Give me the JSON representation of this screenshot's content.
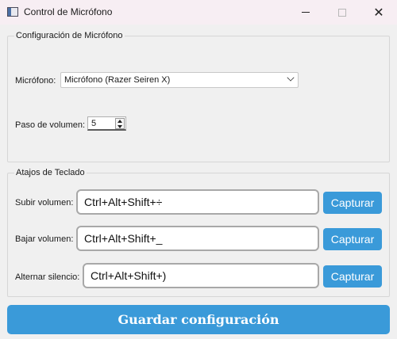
{
  "window": {
    "title": "Control de Micrófono",
    "controls": {
      "minimize": "–",
      "maximize": "☐",
      "close": "✕"
    }
  },
  "microphone_group": {
    "title": "Configuración de Micrófono",
    "microphone_label": "Micrófono:",
    "microphone_value": "Micrófono (Razer Seiren X)",
    "volume_step_label": "Paso de volumen:",
    "volume_step_value": "5"
  },
  "shortcuts_group": {
    "title": "Atajos de Teclado",
    "rows": [
      {
        "label": "Subir volumen:",
        "hotkey": "Ctrl+Alt+Shift+÷",
        "button": "Capturar"
      },
      {
        "label": "Bajar volumen:",
        "hotkey": "Ctrl+Alt+Shift+_",
        "button": "Capturar"
      },
      {
        "label": "Alternar silencio:",
        "hotkey": "Ctrl+Alt+Shift+)",
        "button": "Capturar"
      }
    ]
  },
  "save_button": "Guardar configuración",
  "colors": {
    "accent": "#3a9ad9",
    "titlebar": "#f7eef3",
    "window_bg": "#f0f0f0"
  }
}
